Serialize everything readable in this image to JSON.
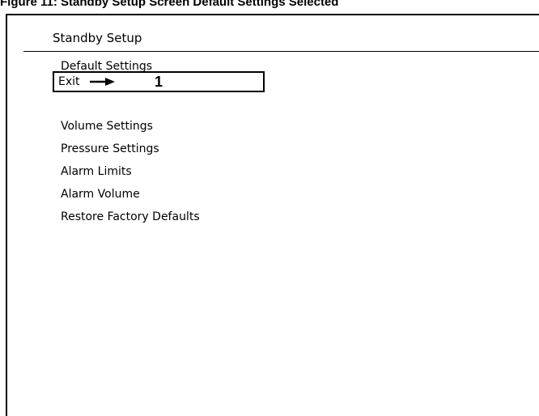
{
  "figure": {
    "caption": "Figure 11: Standby Setup Screen Default Settings Selected"
  },
  "screen": {
    "title": "Standby Setup",
    "section_header": "Default Settings",
    "selected_item": {
      "label": "Exit",
      "callout": "1",
      "arrow_icon": "right-arrow-icon"
    },
    "menu": [
      {
        "label": "Volume Settings"
      },
      {
        "label": "Pressure Settings"
      },
      {
        "label": "Alarm Limits"
      },
      {
        "label": "Alarm Volume"
      },
      {
        "label": "Restore Factory Defaults"
      }
    ]
  }
}
